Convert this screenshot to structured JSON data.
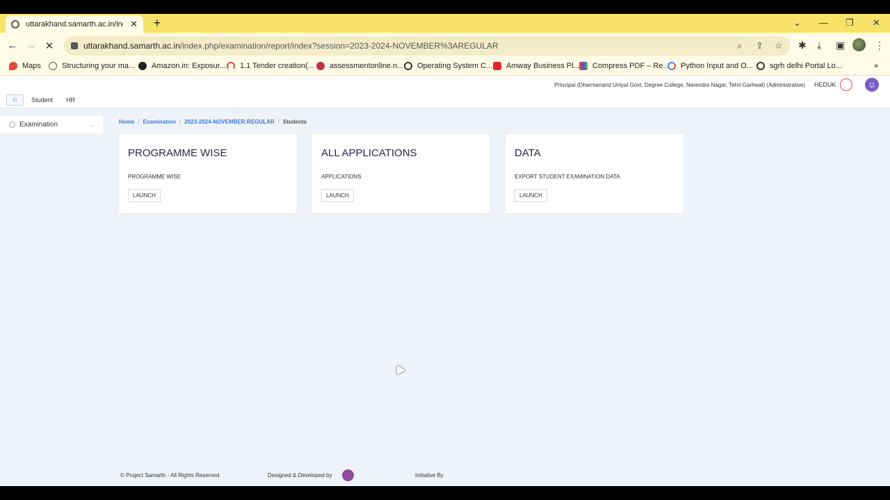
{
  "browser": {
    "tab_title": "uttarakhand.samarth.ac.in/index",
    "new_tab": "+",
    "tab_close": "✕",
    "url_host": "uttarakhand.samarth.ac.in",
    "url_path": "/index.php/examination/report/index?session=2023-2024-NOVEMBER%3AREGULAR",
    "bookmarks": [
      {
        "label": "Maps",
        "color": "#e34b3a"
      },
      {
        "label": "Structuring your ma...",
        "color": "#555555"
      },
      {
        "label": "Amazon.in: Exposur...",
        "color": "#222222"
      },
      {
        "label": "1.1 Tender creation(...",
        "color": "#d44c3a"
      },
      {
        "label": "assessmentonline.n...",
        "color": "#c0304a"
      },
      {
        "label": "Operating System C...",
        "color": "#333333"
      },
      {
        "label": "Amway Business Pl...",
        "color": "#e0282b"
      },
      {
        "label": "Compress PDF – Re...",
        "color": "#6a4bc2"
      },
      {
        "label": "Python Input and O...",
        "color": "#4285f4"
      },
      {
        "label": "sgrh delhi Portal Lo...",
        "color": "#333333"
      }
    ],
    "bookmarks_more": "»"
  },
  "header": {
    "role_text": "Principal (Dharmanand Uniyal Govt. Degree College, Narendra Nagar, Tehri Garhwal) (Administrative)",
    "org_code": "HEDUK",
    "menu": [
      "Student",
      "HR"
    ]
  },
  "sidebar": {
    "items": [
      {
        "label": "Examination"
      }
    ]
  },
  "breadcrumb": {
    "items": [
      "Home",
      "Examination",
      "2023-2024-NOVEMBER:REGULAR"
    ],
    "current": "Students",
    "separator": "/"
  },
  "cards": [
    {
      "title": "PROGRAMME WISE",
      "description": "PROGRAMME WISE",
      "button": "LAUNCH"
    },
    {
      "title": "ALL APPLICATIONS",
      "description": "APPLICATIONS",
      "button": "LAUNCH"
    },
    {
      "title": "DATA",
      "description": "EXPORT STUDENT EXAMINATION DATA",
      "button": "LAUNCH"
    }
  ],
  "footer": {
    "copyright": "© Project Samarth - All Rights Reserved",
    "designed_by": "Designed & Developed by",
    "initiative_by": "Initiative By"
  },
  "colors": {
    "tabstrip": "#f8e36a",
    "page_background": "#eef3f9",
    "link": "#3a7bd5"
  }
}
